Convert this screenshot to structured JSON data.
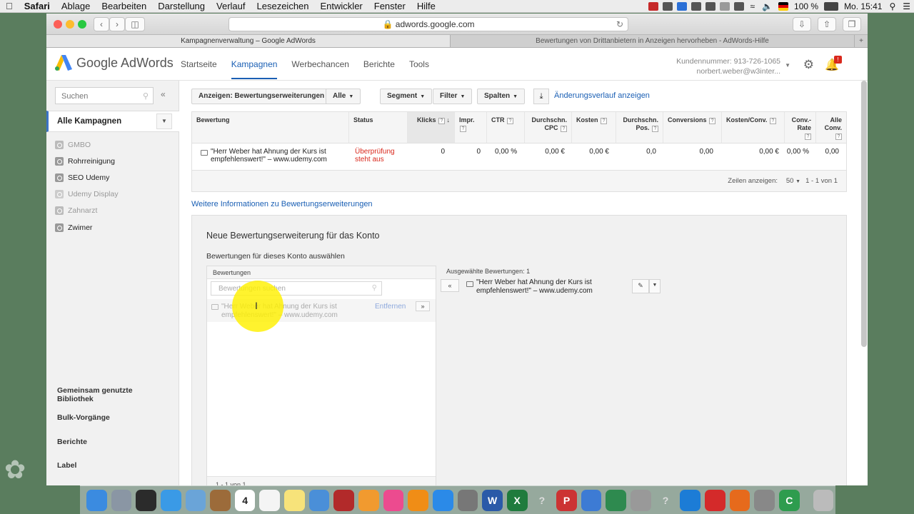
{
  "menubar": {
    "app": "Safari",
    "items": [
      "Ablage",
      "Bearbeiten",
      "Darstellung",
      "Verlauf",
      "Lesezeichen",
      "Entwickler",
      "Fenster",
      "Hilfe"
    ],
    "battery": "100 %",
    "clock": "Mo. 15:41"
  },
  "browser": {
    "url": "adwords.google.com",
    "tabs": [
      {
        "label": "Kampagnenverwaltung – Google AdWords",
        "active": true
      },
      {
        "label": "Bewertungen von Drittanbietern in Anzeigen hervorheben - AdWords-Hilfe",
        "active": false
      }
    ]
  },
  "header": {
    "logo_text": "Google AdWords",
    "nav": [
      {
        "label": "Startseite",
        "active": false
      },
      {
        "label": "Kampagnen",
        "active": true
      },
      {
        "label": "Werbechancen",
        "active": false
      },
      {
        "label": "Berichte",
        "active": false
      },
      {
        "label": "Tools",
        "active": false
      }
    ],
    "customer_number": "Kundennummer: 913-726-1065",
    "email": "norbert.weber@w3inter...",
    "notification_count": "!"
  },
  "sidebar": {
    "search_placeholder": "Suchen",
    "all_campaigns": "Alle Kampagnen",
    "campaigns": [
      {
        "name": "GMBO",
        "status": "paused"
      },
      {
        "name": "Rohrreinigung",
        "status": "active"
      },
      {
        "name": "SEO Udemy",
        "status": "active"
      },
      {
        "name": "Udemy Display",
        "status": "paused"
      },
      {
        "name": "Zahnarzt",
        "status": "paused"
      },
      {
        "name": "Zwimer",
        "status": "active"
      }
    ],
    "bottom": [
      "Gemeinsam genutzte Bibliothek",
      "Bulk-Vorgänge",
      "Berichte",
      "Label"
    ]
  },
  "toolbar": {
    "view": "Anzeigen: Bewertungserweiterungen",
    "all": "Alle",
    "segment": "Segment",
    "filter": "Filter",
    "columns": "Spalten",
    "history": "Änderungsverlauf anzeigen"
  },
  "table": {
    "headers": {
      "review": "Bewertung",
      "status": "Status",
      "clicks": "Klicks",
      "impr": "Impr.",
      "ctr": "CTR",
      "cpc": "Durchschn. CPC",
      "cost": "Kosten",
      "pos": "Durchschn. Pos.",
      "conv": "Conversions",
      "cost_conv": "Kosten/Conv.",
      "conv_rate": "Conv.-Rate",
      "all_conv": "Alle Conv."
    },
    "row": {
      "review": "\"Herr Weber hat Ahnung der Kurs ist empfehlenswert!\" – www.udemy.com",
      "status": "Überprüfung steht aus",
      "clicks": "0",
      "impr": "0",
      "ctr": "0,00 %",
      "cpc": "0,00 €",
      "cost": "0,00 €",
      "pos": "0,0",
      "conv": "0,00",
      "cost_conv": "0,00 €",
      "conv_rate": "0,00 %",
      "all_conv": "0,00"
    },
    "footer": {
      "rows_label": "Zeilen anzeigen:",
      "rows_value": "50",
      "range": "1 - 1 von 1"
    }
  },
  "more_info": "Weitere Informationen zu Bewertungserweiterungen",
  "new_panel": {
    "title": "Neue Bewertungserweiterung für das Konto",
    "subtitle": "Bewertungen für dieses Konto auswählen",
    "list_header": "Bewertungen",
    "search_placeholder": "Bewertungen suchen",
    "item_text": "\"Herr Weber hat Ahnung der Kurs ist empfehlenswert!\" – www.udemy.com",
    "remove": "Entfernen",
    "add_arrow": "»",
    "list_footer": "1 - 1 von 1",
    "selected_label": "Ausgewählte Bewertungen: 1",
    "remove_arrow": "«",
    "selected_item": "\"Herr Weber hat Ahnung der Kurs ist empfehlenswert!\" – www.udemy.com"
  },
  "colors": {
    "accent": "#1a5fb4",
    "warning": "#d9281c",
    "sidebar_bg": "#f1f1f1"
  }
}
